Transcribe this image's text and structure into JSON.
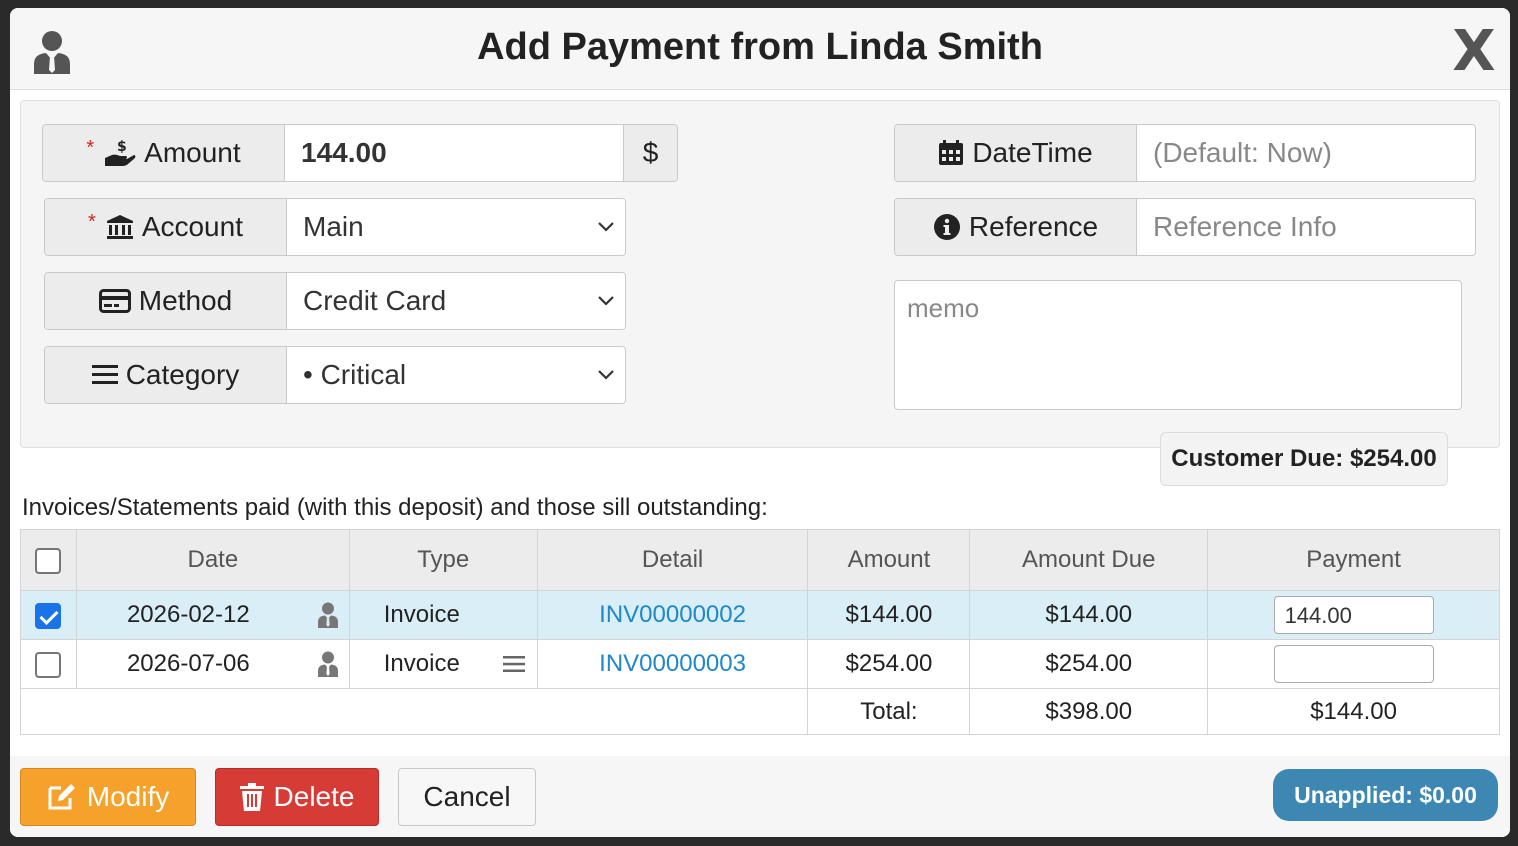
{
  "header": {
    "title": "Add Payment from Linda Smith",
    "close_label": "X"
  },
  "form": {
    "amount": {
      "label": "Amount",
      "required_mark": "*",
      "value": "144.00",
      "addon": "$"
    },
    "account": {
      "label": "Account",
      "required_mark": "*",
      "value": "Main"
    },
    "method": {
      "label": "Method",
      "value": "Credit Card"
    },
    "category": {
      "label": "Category",
      "value": "• Critical"
    },
    "datetime": {
      "label": "DateTime",
      "placeholder": "(Default: Now)"
    },
    "reference": {
      "label": "Reference",
      "placeholder": "Reference Info"
    },
    "memo": {
      "placeholder": "memo"
    }
  },
  "customer_due": "Customer Due: $254.00",
  "invoices": {
    "section_title": "Invoices/Statements paid (with this deposit) and those sill outstanding:",
    "columns": [
      "Date",
      "Type",
      "Detail",
      "Amount",
      "Amount Due",
      "Payment"
    ],
    "rows": [
      {
        "checked": true,
        "date": "2026-02-12",
        "type": "Invoice",
        "detail": "INV00000002",
        "amount": "$144.00",
        "amount_due": "$144.00",
        "payment": "144.00"
      },
      {
        "checked": false,
        "date": "2026-07-06",
        "type": "Invoice",
        "detail": "INV00000003",
        "amount": "$254.00",
        "amount_due": "$254.00",
        "payment": ""
      }
    ],
    "total": {
      "label": "Total:",
      "amount_due": "$398.00",
      "payment": "$144.00"
    }
  },
  "footer": {
    "modify_label": "Modify",
    "delete_label": "Delete",
    "cancel_label": "Cancel",
    "unapplied": "Unapplied: $0.00"
  },
  "colors": {
    "modify": "#f6a12b",
    "delete": "#d63b35",
    "unapplied": "#3d87b3",
    "link": "#1e88c8",
    "selected_row": "#d9eef6",
    "required": "#d9241b"
  }
}
